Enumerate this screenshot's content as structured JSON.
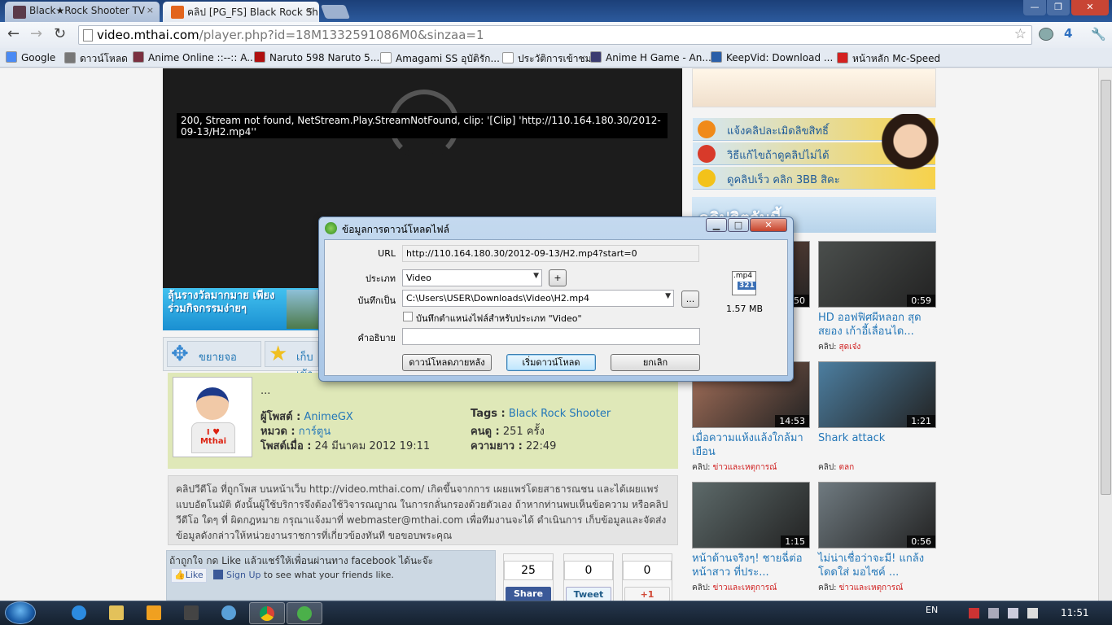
{
  "browser": {
    "tabs": [
      {
        "label": "Black★Rock Shooter TV",
        "close": "×"
      },
      {
        "label": "คลิป [PG_FS] Black Rock Sh",
        "close": "×"
      }
    ],
    "window_controls": {
      "minimize": "—",
      "maximize": "❐",
      "close": "✕"
    },
    "nav": {
      "back": "←",
      "forward": "→",
      "reload": "↻"
    },
    "url_domain": "video.mthai.com",
    "url_path": "/player.php?id=18M1332591086M0&sinzaa=1",
    "bookmark_star": "☆",
    "ext_badge": "4",
    "menu_icon": "🔧",
    "bookmarks": [
      {
        "label": "Google",
        "color": "#4a8af4"
      },
      {
        "label": "ดาวน์โหลด",
        "color": "#777777"
      },
      {
        "label": "Anime Online ::--:: A...",
        "color": "#7a3040"
      },
      {
        "label": "Naruto 598 Naruto 5...",
        "color": "#b01010"
      },
      {
        "label": "Amagami SS อุบัติรัก...",
        "color": "#ffffff"
      },
      {
        "label": "ประวัติการเข้าชม",
        "color": "#ffffff"
      },
      {
        "label": "Anime H Game - An...",
        "color": "#3c3c70"
      },
      {
        "label": "KeepVid: Download ...",
        "color": "#2b5fa8"
      },
      {
        "label": "หน้าหลัก Mc-Speed",
        "color": "#d42020"
      }
    ]
  },
  "player": {
    "error": "200, Stream not found, NetStream.Play.StreamNotFound, clip: '[Clip] 'http://110.164.180.30/2012-09-13/H2.mp4''"
  },
  "banner": {
    "text": "ลุ้นรางวัลมากมาย เพียงร่วมกิจกรรมง่ายๆ"
  },
  "actions": {
    "expand": "ขยายจอ",
    "favorite": "เก็บเข้า"
  },
  "info": {
    "dots": "...",
    "uploader_label": "ผู้โพสต์ :",
    "uploader": "AnimeGX",
    "category_label": "หมวด :",
    "category": "การ์ตูน",
    "posted_label": "โพสต์เมื่อ :",
    "posted": "24 มีนาคม 2012 19:11",
    "tags_label": "Tags :",
    "tags": "Black Rock Shooter",
    "views_label": "คนดู :",
    "views": "251 ครั้ง",
    "length_label": "ความยาว :",
    "length": "22:49",
    "avatar_logo": "I ♥ Mthai"
  },
  "description": "คลิปวีดีโอ ที่ถูกโพส บนหน้าเว็บ http://video.mthai.com/ เกิดขึ้นจากการ เผยแพร่โดยสาธารณชน และได้เผยแพร่แบบอัตโนมัติ ดังนั้นผู้ใช้บริการจึงต้องใช้วิจารณญาณ ในการกลั่นกรองด้วยตัวเอง ถ้าหากท่านพบเห็นข้อความ หรือคลิปวีดีโอ ใดๆ ที่ ผิดกฎหมาย กรุณาแจ้งมาที่ webmaster@mthai.com เพื่อทีมงานจะได้ ดำเนินการ เก็บข้อมูลและจัดส่งข้อมูลดังกล่าวให้หน่วยงานราชการที่เกี่ยวข้องทันที ขอขอบพระคุณ",
  "social": {
    "prompt": "ถ้าถูกใจ กด Like แล้วแชร์ให้เพื่อนผ่านทาง facebook ได้นะจ๊ะ",
    "like": "Like",
    "signup": "Sign Up",
    "signup_rest": " to see what your friends like.",
    "share_count": "25",
    "share_label": "Share",
    "tweet_count": "0",
    "tweet_label": "Tweet",
    "plus_count": "0",
    "plus_label": "+1"
  },
  "sidebar": {
    "promos": [
      {
        "label": "แจ้งคลิปละเมิดลิขสิทธิ์",
        "color": "#f08a1a"
      },
      {
        "label": "วิธีแก้ไขถ้าดูคลิปไม่ได้",
        "color": "#d83a2a"
      },
      {
        "label": "ดูคลิปเร็ว คลิก 3BB สิคะ",
        "color": "#f3c21a"
      }
    ],
    "heading": "คลิปฮิตวันนี้",
    "videos": [
      {
        "title": "...",
        "duration": "1:50",
        "category_label": "",
        "category": "",
        "color": "#8a5a48"
      },
      {
        "title": "HD ออฟฟิศผีหลอก สุดสยอง เก้าอี้เลื่อนได...",
        "duration": "0:59",
        "category_label": "คลิป:",
        "category": "สุดเจ๋ง",
        "color": "#4a4e4c"
      },
      {
        "title": "เมื่อความแห้งแล้งใกล้มาเยือน",
        "duration": "14:53",
        "category_label": "คลิป:",
        "category": "ข่าวและเหตุการณ์",
        "color": "#a5705a"
      },
      {
        "title": "Shark attack",
        "duration": "1:21",
        "category_label": "คลิป:",
        "category": "ตลก",
        "color": "#4c7ea0"
      },
      {
        "title": "หน้าด้านจริงๆ! ชายฉี่ต่อหน้าสาว ที่ประ...",
        "duration": "1:15",
        "category_label": "คลิป:",
        "category": "ข่าวและเหตุการณ์",
        "color": "#5d6a6a"
      },
      {
        "title": "ไม่น่าเชื่อว่าจะมี! แกล้งโดดใส่ มอไซค์ ...",
        "duration": "0:56",
        "category_label": "คลิป:",
        "category": "ข่าวและเหตุการณ์",
        "color": "#6f7a80"
      }
    ]
  },
  "dialog": {
    "title": "ข้อมูลการดาวน์โหลดไฟล์",
    "controls": {
      "minimize": "▁",
      "maximize": "□",
      "close": "✕"
    },
    "url_label": "URL",
    "url": "http://110.164.180.30/2012-09-13/H2.mp4?start=0",
    "type_label": "ประเภท",
    "type_value": "Video",
    "add_button": "+",
    "save_label": "บันทึกเป็น",
    "save_path": "C:\\Users\\USER\\Downloads\\Video\\H2.mp4",
    "browse_button": "...",
    "remember_label": "บันทึกตำแหน่งไฟล์สำหรับประเภท \"Video\"",
    "desc_label": "คำอธิบาย",
    "desc_value": "",
    "later_button": "ดาวน์โหลดภายหลัง",
    "start_button": "เริ่มดาวน์โหลด",
    "cancel_button": "ยกเลิก",
    "file_ext": ".mp4",
    "file_badge": "321",
    "file_size": "1.57 MB"
  },
  "taskbar": {
    "lang": "EN",
    "clock": "11:51"
  }
}
